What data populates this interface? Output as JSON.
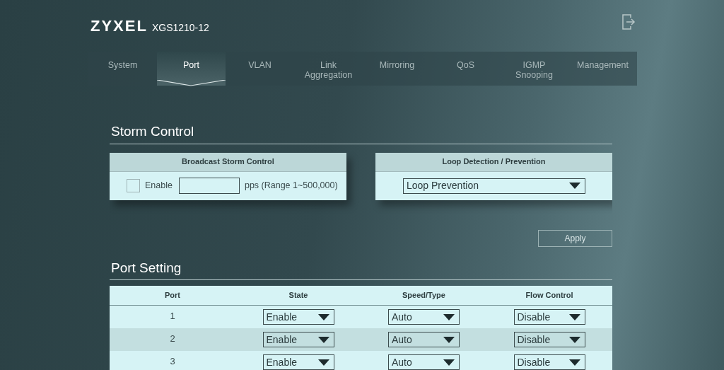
{
  "header": {
    "logo": "ZYXEL",
    "model": "XGS1210-12"
  },
  "tabs": [
    {
      "label": "System",
      "selected": false
    },
    {
      "label": "Port",
      "selected": true
    },
    {
      "label": "VLAN",
      "selected": false
    },
    {
      "label": "Link Aggregation",
      "selected": false
    },
    {
      "label": "Mirroring",
      "selected": false
    },
    {
      "label": "QoS",
      "selected": false
    },
    {
      "label": "IGMP Snooping",
      "selected": false
    },
    {
      "label": "Management",
      "selected": false
    }
  ],
  "storm_control": {
    "title": "Storm Control",
    "broadcast": {
      "title": "Broadcast Storm Control",
      "enable_label": "Enable",
      "checked": false,
      "unit": "pps (Range 1~500,000)"
    },
    "loop": {
      "title": "Loop Detection / Prevention",
      "value": "Loop Prevention"
    },
    "apply": "Apply"
  },
  "port_setting": {
    "title": "Port Setting",
    "columns": [
      "Port",
      "State",
      "Speed/Type",
      "Flow Control"
    ],
    "rows": [
      {
        "kind": "full",
        "port": "1",
        "state": "Enable",
        "speed": "Auto",
        "flow": "Disable"
      },
      {
        "kind": "full",
        "port": "2",
        "state": "Enable",
        "speed": "Auto",
        "flow": "Disable"
      },
      {
        "kind": "full",
        "port": "3",
        "state": "Enable",
        "speed": "Auto",
        "flow": "Disable"
      },
      {
        "kind": "cut"
      }
    ]
  }
}
